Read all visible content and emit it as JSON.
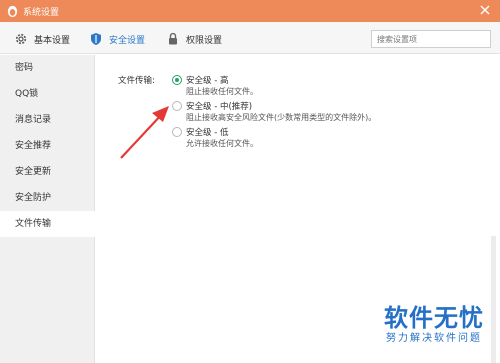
{
  "window": {
    "title": "系统设置"
  },
  "tabs": [
    {
      "label": "基本设置",
      "icon": "gear-icon"
    },
    {
      "label": "安全设置",
      "icon": "shield-icon"
    },
    {
      "label": "权限设置",
      "icon": "lock-icon"
    }
  ],
  "active_tab": "安全设置",
  "search": {
    "placeholder": "搜索设置项"
  },
  "sidebar": {
    "items": [
      {
        "label": "密码"
      },
      {
        "label": "QQ锁"
      },
      {
        "label": "消息记录"
      },
      {
        "label": "安全推荐"
      },
      {
        "label": "安全更新"
      },
      {
        "label": "安全防护"
      },
      {
        "label": "文件传输"
      }
    ],
    "active": "文件传输"
  },
  "file_transfer": {
    "label": "文件传输:",
    "options": [
      {
        "title": "安全级 - 高",
        "desc": "阻止接收任何文件。",
        "checked": true
      },
      {
        "title": "安全级 - 中(推荐)",
        "desc": "阻止接收高安全风险文件(少数常用类型的文件除外)。",
        "checked": false
      },
      {
        "title": "安全级 - 低",
        "desc": "允许接收任何文件。",
        "checked": false
      }
    ]
  },
  "annotation": {
    "arrow_color": "#e53935"
  },
  "colors": {
    "titlebar": "#ee8a5a",
    "accent": "#2a78c8",
    "radio_checked": "#26a269"
  },
  "watermark": {
    "line1": "软件无忧",
    "line2": "努力解决软件问题"
  }
}
